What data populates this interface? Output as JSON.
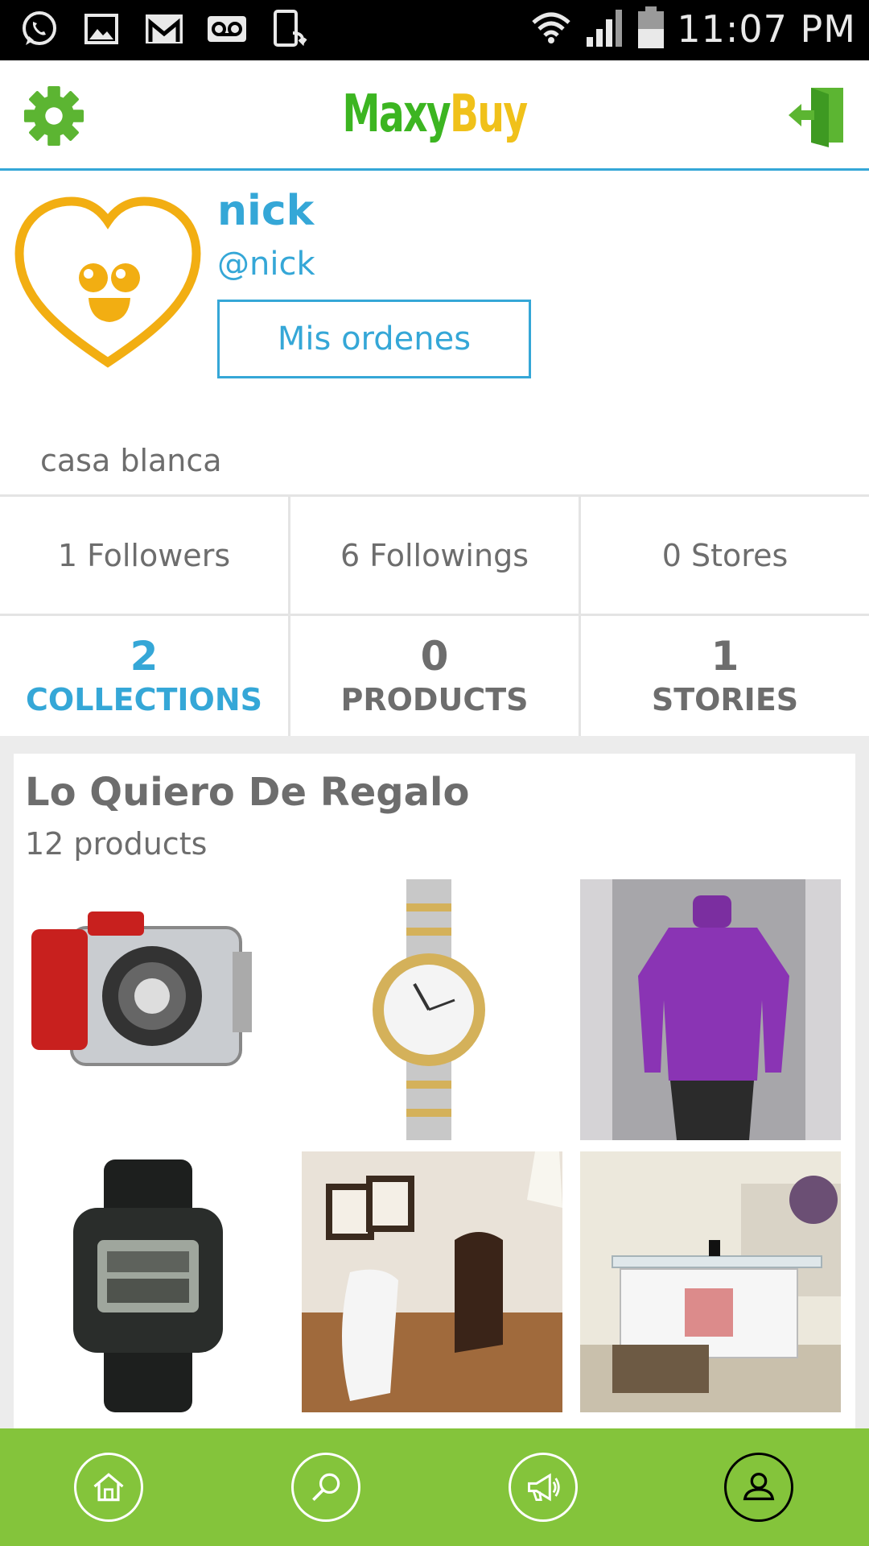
{
  "status_bar": {
    "time": "11:07 PM",
    "left_icons": [
      "whatsapp-icon",
      "image-icon",
      "gmail-icon",
      "voicemail-icon",
      "phone-sync-icon"
    ],
    "right_icons": [
      "wifi-icon",
      "signal-icon",
      "battery-icon"
    ]
  },
  "header": {
    "logo_part1": "Maxy",
    "logo_part2": "Buy",
    "settings_icon": "gear-icon",
    "logout_icon": "logout-icon"
  },
  "profile": {
    "name": "nick",
    "handle": "@nick",
    "orders_button": "Mis ordenes",
    "location": "casa blanca",
    "avatar_icon": "heart-smiley-icon"
  },
  "stats": {
    "followers": "1 Followers",
    "followings": "6 Followings",
    "stores": "0 Stores"
  },
  "tabs": [
    {
      "count": "2",
      "label": "COLLECTIONS",
      "active": true
    },
    {
      "count": "0",
      "label": "PRODUCTS",
      "active": false
    },
    {
      "count": "1",
      "label": "STORIES",
      "active": false
    }
  ],
  "collection": {
    "title": "Lo Quiero De Regalo",
    "subtitle": "12 products",
    "items": [
      "camera-housing-image",
      "gold-watch-image",
      "purple-sweater-image",
      "g-shock-watch-image",
      "floor-chair-image",
      "coffee-table-image"
    ]
  },
  "bottom_nav": [
    "home-icon",
    "search-icon",
    "megaphone-icon",
    "profile-icon"
  ],
  "colors": {
    "accent": "#35a7d7",
    "brand_green": "#84c43b",
    "logo_green": "#3cb521",
    "logo_yellow": "#f0c11a",
    "text_gray": "#6d6d6d"
  }
}
